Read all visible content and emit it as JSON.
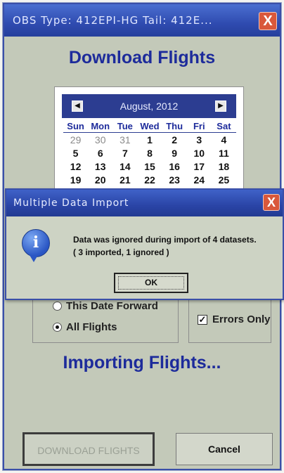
{
  "main_window": {
    "title": "OBS     Type: 412EPI-HG    Tail: 412E...",
    "close_label": "X",
    "heading": "Download Flights",
    "calendar": {
      "month_label": "August, 2012",
      "prev_label": "◀",
      "next_label": "▶",
      "days_of_week": [
        "Sun",
        "Mon",
        "Tue",
        "Wed",
        "Thu",
        "Fri",
        "Sat"
      ],
      "weeks": [
        [
          "29",
          "30",
          "31",
          "1",
          "2",
          "3",
          "4"
        ],
        [
          "5",
          "6",
          "7",
          "8",
          "9",
          "10",
          "11"
        ],
        [
          "12",
          "13",
          "14",
          "15",
          "16",
          "17",
          "18"
        ],
        [
          "19",
          "20",
          "21",
          "22",
          "23",
          "24",
          "25"
        ]
      ]
    },
    "filters": {
      "option_1": "This Date Forward",
      "option_2": "All Flights",
      "selected": "All Flights"
    },
    "errors_only": {
      "label": "Errors Only",
      "checked": true
    },
    "status_heading": "Importing Flights...",
    "download_button": "DOWNLOAD FLIGHTS",
    "cancel_button": "Cancel"
  },
  "dialog": {
    "title": "Multiple Data Import",
    "close_label": "X",
    "message_line_1": "Data was ignored during import of 4 datasets.",
    "message_line_2": "( 3 imported, 1 ignored )",
    "ok_button": "OK"
  },
  "colors": {
    "titlebar": "#2f4bb0",
    "heading": "#1d2b9b",
    "window_bg": "#c3c9b9",
    "close_button": "#d9583b"
  }
}
